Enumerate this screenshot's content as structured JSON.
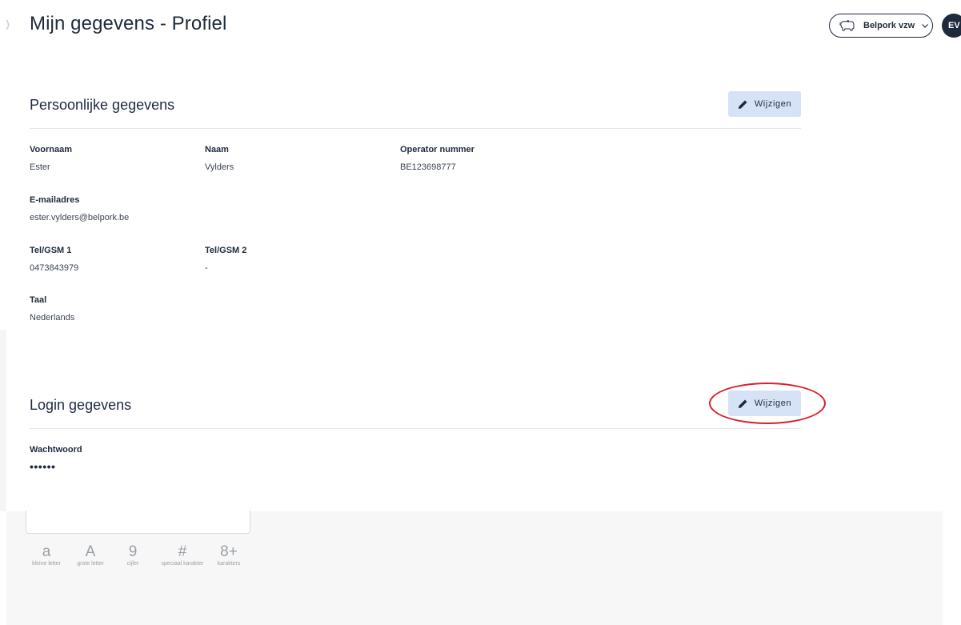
{
  "header": {
    "title": "Mijn gegevens - Profiel",
    "organization": "Belpork vzw",
    "avatar_initials": "EV"
  },
  "personal": {
    "title": "Persoonlijke gegevens",
    "edit_label": "Wijzigen",
    "fields": {
      "first_name": {
        "label": "Voornaam",
        "value": "Ester"
      },
      "last_name": {
        "label": "Naam",
        "value": "Vylders"
      },
      "operator": {
        "label": "Operator nummer",
        "value": "BE123698777"
      },
      "email": {
        "label": "E-mailadres",
        "value": "ester.vylders@belpork.be"
      },
      "phone1": {
        "label": "Tel/GSM 1",
        "value": "0473843979"
      },
      "phone2": {
        "label": "Tel/GSM 2",
        "value": "-"
      },
      "language": {
        "label": "Taal",
        "value": "Nederlands"
      }
    }
  },
  "login": {
    "title": "Login gegevens",
    "edit_label": "Wijzigen",
    "password_label": "Wachtwoord",
    "password_value": "••••••"
  },
  "password_requirements": [
    {
      "symbol": "a",
      "caption": "kleine letter"
    },
    {
      "symbol": "A",
      "caption": "grote letter"
    },
    {
      "symbol": "9",
      "caption": "cijfer"
    },
    {
      "symbol": "#",
      "caption": "speciaal karakter"
    },
    {
      "symbol": "8+",
      "caption": "karakters"
    }
  ],
  "colors": {
    "accent": "#1f2a3d",
    "button_bg": "#d6e3f6",
    "highlight": "#d9212b"
  },
  "icons": {
    "sidebar_toggle": "chevron-right-icon",
    "organization": "pig-icon",
    "dropdown": "chevron-down-icon",
    "edit": "pencil-icon"
  }
}
